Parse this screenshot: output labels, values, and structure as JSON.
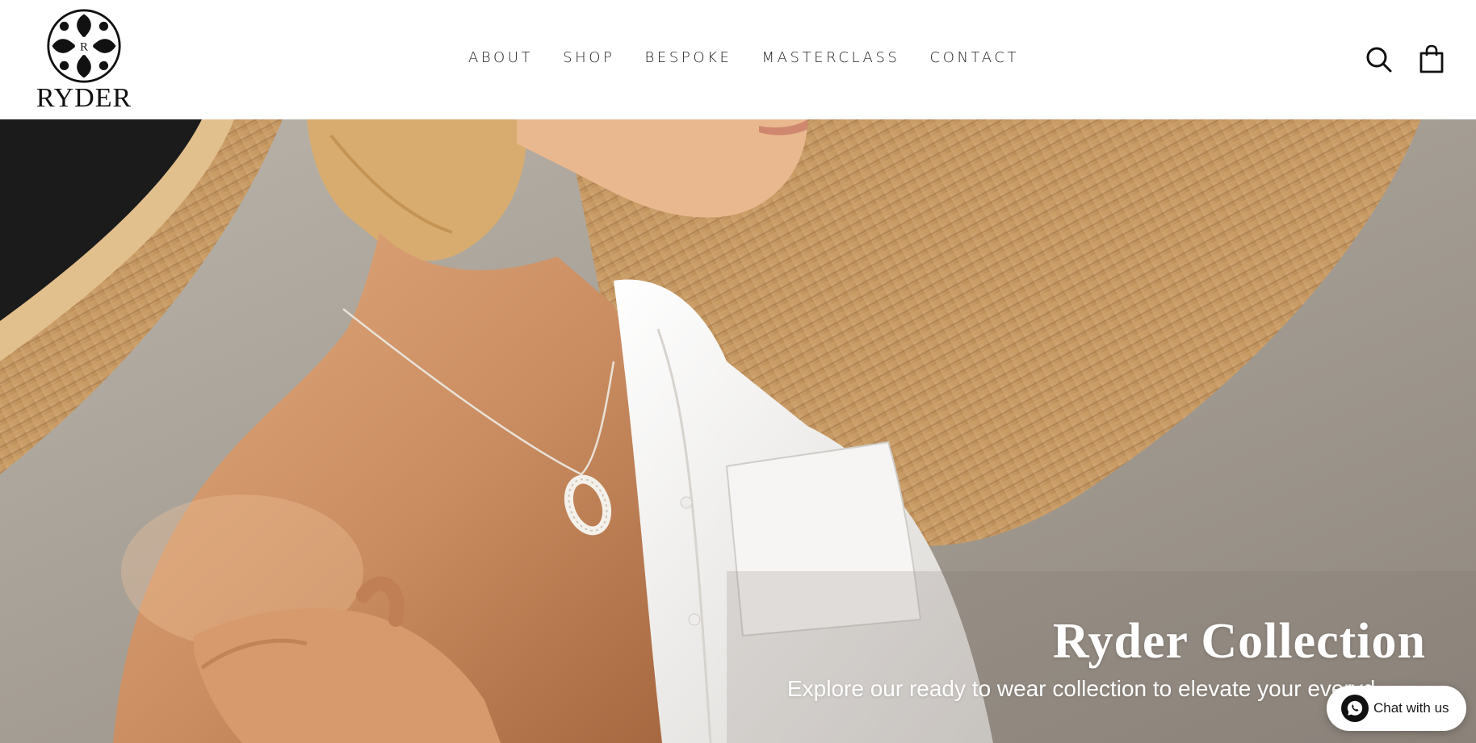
{
  "brand": {
    "name": "RYDER",
    "monogram": "R"
  },
  "nav": {
    "items": [
      {
        "label": "ABOUT"
      },
      {
        "label": "SHOP"
      },
      {
        "label": "BESPOKE"
      },
      {
        "label": "MASTERCLASS"
      },
      {
        "label": "CONTACT"
      }
    ]
  },
  "header_icons": {
    "search": "search-icon",
    "cart": "shopping-bag-icon"
  },
  "hero": {
    "title": "Ryder Collection",
    "subtitle": "Explore our ready to wear collection to elevate your everyd"
  },
  "chat": {
    "label": "Chat with us",
    "icon": "whatsapp-icon"
  },
  "colors": {
    "text_dark": "#1c1c1c",
    "hero_text": "#ffffff",
    "header_bg": "#ffffff"
  }
}
